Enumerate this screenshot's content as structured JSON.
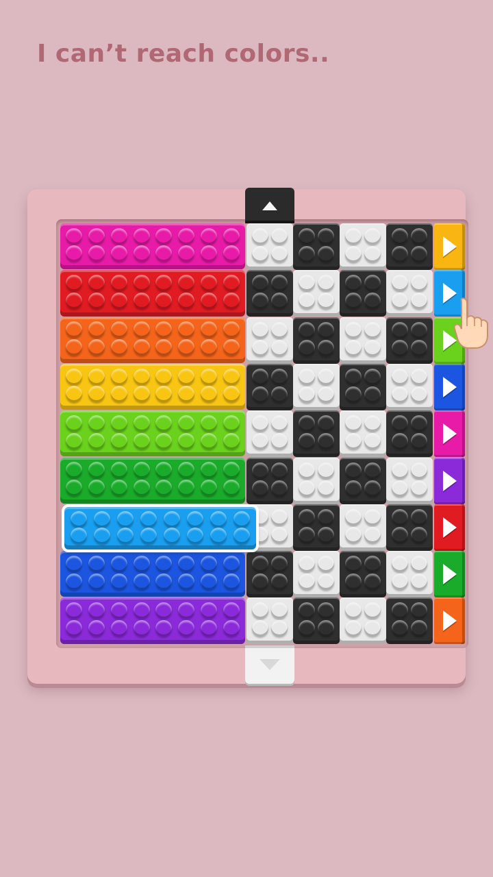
{
  "caption": "I can’t reach colors..",
  "colors": {
    "background": "#dcb9c1",
    "board": "#e7b8bd",
    "caption": "#b06874",
    "white_cell": "#e8e8e8",
    "black_cell": "#2f2f2f"
  },
  "bricks": [
    {
      "color_name": "magenta",
      "color": "#e81ba8",
      "selected": false
    },
    {
      "color_name": "red",
      "color": "#e01b22",
      "selected": false
    },
    {
      "color_name": "orange",
      "color": "#f4641a",
      "selected": false
    },
    {
      "color_name": "yellow",
      "color": "#f9c513",
      "selected": false
    },
    {
      "color_name": "lime",
      "color": "#6ad11c",
      "selected": false
    },
    {
      "color_name": "green",
      "color": "#1bab2b",
      "selected": false
    },
    {
      "color_name": "light-blue",
      "color": "#1a9ff0",
      "selected": true
    },
    {
      "color_name": "blue",
      "color": "#1c56e0",
      "selected": false
    },
    {
      "color_name": "purple",
      "color": "#8a2ad9",
      "selected": false
    }
  ],
  "checkerboard": {
    "rows": 9,
    "cols": 4,
    "top_left": "white"
  },
  "side_tabs": [
    {
      "color_name": "yellow",
      "color": "#f9b613",
      "icon": "play-arrow-icon"
    },
    {
      "color_name": "light-blue",
      "color": "#1a9ff0",
      "icon": "play-arrow-icon"
    },
    {
      "color_name": "lime",
      "color": "#6ad11c",
      "icon": "play-arrow-icon"
    },
    {
      "color_name": "blue",
      "color": "#1c56e0",
      "icon": "play-arrow-icon"
    },
    {
      "color_name": "magenta",
      "color": "#e81ba8",
      "icon": "play-arrow-icon"
    },
    {
      "color_name": "purple",
      "color": "#8a2ad9",
      "icon": "play-arrow-icon"
    },
    {
      "color_name": "red",
      "color": "#e01b22",
      "icon": "play-arrow-icon"
    },
    {
      "color_name": "green",
      "color": "#1bab2b",
      "icon": "play-arrow-icon"
    },
    {
      "color_name": "orange",
      "color": "#f4641a",
      "icon": "play-arrow-icon"
    }
  ],
  "top_slider_cap_icon": "arrow-up-icon",
  "bottom_slider_cap_icon": "arrow-down-icon",
  "pointer_icon": "tap-hand-icon"
}
